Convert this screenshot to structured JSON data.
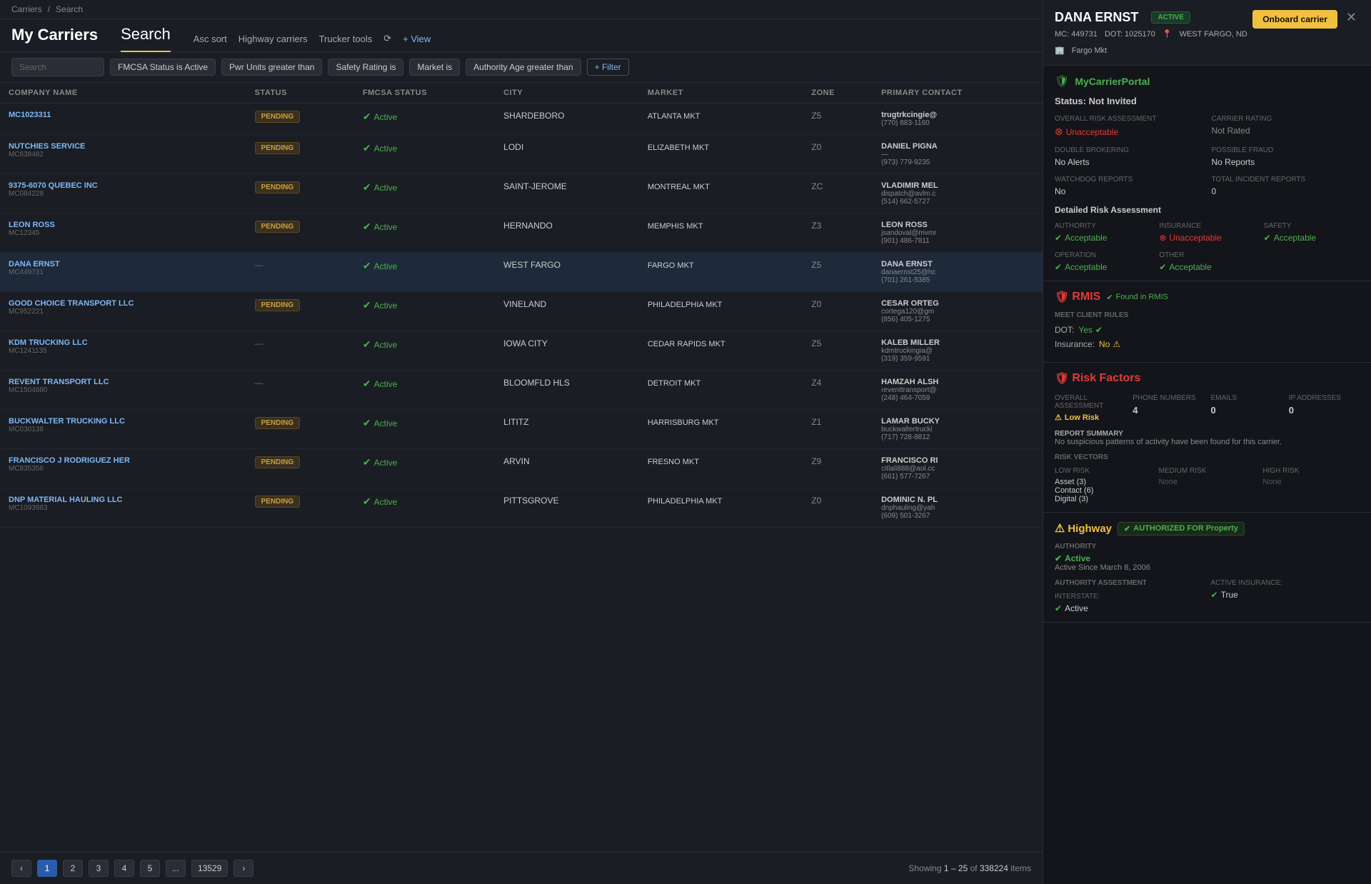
{
  "breadcrumb": {
    "carriers": "Carriers",
    "separator": "/",
    "search": "Search"
  },
  "header": {
    "title": "My Carriers",
    "search_tab": "Search",
    "actions": [
      {
        "label": "Asc sort",
        "name": "asc-sort"
      },
      {
        "label": "Highway carriers",
        "name": "highway-carriers"
      },
      {
        "label": "Trucker tools",
        "name": "trucker-tools"
      },
      {
        "label": "+ View",
        "name": "view"
      }
    ]
  },
  "filters": {
    "search_placeholder": "Search",
    "chips": [
      {
        "label": "FMCSA Status is Active",
        "name": "fmcsa-filter"
      },
      {
        "label": "Pwr Units greater than",
        "name": "pwr-filter"
      },
      {
        "label": "Safety Rating is",
        "name": "safety-filter"
      },
      {
        "label": "Market is",
        "name": "market-filter"
      },
      {
        "label": "Authority Age greater than",
        "name": "authority-filter"
      }
    ],
    "add_filter": "+ Filter"
  },
  "table": {
    "columns": [
      "Company Name",
      "Status",
      "FMCSA Status",
      "City",
      "Market",
      "Zone",
      "Primary Contact"
    ],
    "rows": [
      {
        "company": "MC1023311",
        "status": "PENDING",
        "fmcsa": "Active",
        "city": "SHARDEBORO",
        "market": "ATLANTA MKT",
        "zone": "Z5",
        "contact_name": "trugtrkcingie@",
        "contact_phone": "(770) 883-1160"
      },
      {
        "company": "NUTCHIES SERVICE",
        "mc": "MC638482",
        "status": "PENDING",
        "fmcsa": "Active",
        "city": "LODI",
        "market": "ELIZABETH MKT",
        "zone": "Z0",
        "contact_name": "DANIEL PIGNA",
        "contact_extra": "—",
        "contact_phone": "(973) 779-9235"
      },
      {
        "company": "9375-6070 QUEBEC INC",
        "mc": "MC084228",
        "status": "PENDING",
        "fmcsa": "Active",
        "city": "SAINT-JEROME",
        "market": "MONTREAL MKT",
        "zone": "ZC",
        "contact_name": "VLADIMIR MEL",
        "contact_email": "dispatch@avlm.c",
        "contact_phone": "(514) 662-5727"
      },
      {
        "company": "LEON ROSS",
        "mc": "MC12345",
        "status": "PENDING",
        "fmcsa": "Active",
        "city": "HERNANDO",
        "market": "MEMPHIS MKT",
        "zone": "Z3",
        "contact_name": "LEON ROSS",
        "contact_email": "jsandoval@mvmr",
        "contact_phone": "(901) 486-7811"
      },
      {
        "company": "DANA ERNST",
        "mc": "MC449731",
        "status": "",
        "fmcsa": "Active",
        "city": "WEST FARGO",
        "market": "FARGO MKT",
        "zone": "Z5",
        "contact_name": "DANA ERNST",
        "contact_email": "danaernst25@hc",
        "contact_phone": "(701) 261-5385",
        "selected": true
      },
      {
        "company": "GOOD CHOICE TRANSPORT LLC",
        "mc": "MC952221",
        "status": "PENDING",
        "fmcsa": "Active",
        "city": "VINELAND",
        "market": "PHILADELPHIA MKT",
        "zone": "Z0",
        "contact_name": "CESAR ORTEG",
        "contact_email": "cortega120@gm",
        "contact_phone": "(856) 405-1275"
      },
      {
        "company": "KDM TRUCKING LLC",
        "mc": "MC1241135",
        "status": "",
        "fmcsa": "Active",
        "city": "IOWA CITY",
        "market": "CEDAR RAPIDS MKT",
        "zone": "Z5",
        "contact_name": "KALEB MILLER",
        "contact_email": "kdmtruckingia@",
        "contact_phone": "(319) 359-9591"
      },
      {
        "company": "REVENT TRANSPORT LLC",
        "mc": "MC1504880",
        "status": "",
        "fmcsa": "Active",
        "city": "BLOOMFLD HLS",
        "market": "DETROIT MKT",
        "zone": "Z4",
        "contact_name": "HAMZAH ALSH",
        "contact_email": "reventtransport@",
        "contact_phone": "(248) 464-7059"
      },
      {
        "company": "BUCKWALTER TRUCKING LLC",
        "mc": "MC030138",
        "status": "PENDING",
        "fmcsa": "Active",
        "city": "LITITZ",
        "market": "HARRISBURG MKT",
        "zone": "Z1",
        "contact_name": "LAMAR BUCKY",
        "contact_email": "buckwaltertrucki",
        "contact_phone": "(717) 728-8812"
      },
      {
        "company": "FRANCISCO J RODRIGUEZ HER",
        "mc": "MC835356",
        "status": "PENDING",
        "fmcsa": "Active",
        "city": "ARVIN",
        "market": "FRESNO MKT",
        "zone": "Z9",
        "contact_name": "FRANCISCO RI",
        "contact_email": "citlali888@aol.cc",
        "contact_phone": "(661) 577-7267"
      },
      {
        "company": "DNP MATERIAL HAULING LLC",
        "mc": "MC1093983",
        "status": "PENDING",
        "fmcsa": "Active",
        "city": "PITTSGROVE",
        "market": "PHILADELPHIA MKT",
        "zone": "Z0",
        "contact_name": "DOMINIC N. PL",
        "contact_email": "dnphauling@yah",
        "contact_phone": "(609) 501-3267"
      }
    ]
  },
  "pagination": {
    "prev": "‹",
    "next": "›",
    "pages": [
      "1",
      "2",
      "3",
      "4",
      "5",
      "...",
      "13529"
    ],
    "current": "1",
    "showing_text": "Showing",
    "range": "1 – 25",
    "of": "of",
    "total": "338224",
    "items": "items"
  },
  "right_panel": {
    "carrier_name": "DANA ERNST",
    "status_badge": "ACTIVE",
    "onboard_btn": "Onboard carrier",
    "meta": {
      "mc": "MC: 449731",
      "dot": "DOT: 1025170",
      "location": "WEST FARGO, ND",
      "market": "Fargo Mkt"
    },
    "portal": "MyCarrierPortal",
    "status_section": {
      "title": "Status: Not Invited"
    },
    "overall_risk": {
      "label": "OVERALL RISK ASSESSMENT",
      "value": "Unacceptable"
    },
    "carrier_rating": {
      "label": "CARRIER RATING",
      "value": "Not Rated"
    },
    "double_brokering": {
      "label": "DOUBLE BROKERING",
      "value": "No Alerts"
    },
    "possible_fraud": {
      "label": "POSSIBLE FRAUD",
      "value": "No Reports"
    },
    "watchdog": {
      "label": "WATCHDOG REPORTS",
      "value": "No"
    },
    "total_incident": {
      "label": "TOTAL INCIDENT REPORTS",
      "value": "0"
    },
    "detailed_risk": {
      "title": "Detailed Risk Assessment",
      "authority": {
        "label": "AUTHORITY",
        "value": "Acceptable",
        "type": "ok"
      },
      "insurance": {
        "label": "INSURANCE",
        "value": "Unacceptable",
        "type": "warn"
      },
      "safety": {
        "label": "SAFETY",
        "value": "Acceptable",
        "type": "ok"
      },
      "operation": {
        "label": "OPERATION",
        "value": "Acceptable",
        "type": "ok"
      },
      "other": {
        "label": "OTHER",
        "value": "Acceptable",
        "type": "ok"
      }
    },
    "rmis": {
      "logo": "RMIS",
      "found": "Found in RMIS",
      "meet_rules_title": "MEET CLIENT RULES",
      "dot_label": "DOT:",
      "dot_value": "Yes",
      "insurance_label": "Insurance:",
      "insurance_value": "No"
    },
    "risk_factors": {
      "logo": "Risk Factors",
      "overall": {
        "label": "OVERALL ASSESSMENT",
        "value": "Low Risk"
      },
      "phone_numbers": {
        "label": "PHONE NUMBERS",
        "value": "4"
      },
      "emails": {
        "label": "EMAILS",
        "value": "0"
      },
      "ip_addresses": {
        "label": "IP ADDRESSES",
        "value": "0"
      },
      "report_title": "REPORT SUMMARY",
      "report_text": "No suspicious patterns of activity have been found for this carrier.",
      "risk_vectors_title": "RISK VECTORS",
      "low_risk": {
        "label": "LOW RISK",
        "value": "Asset (3)\nContact (6)\nDigital (3)"
      },
      "medium_risk": {
        "label": "MEDIUM RISK",
        "value": "None"
      },
      "high_risk": {
        "label": "HIGH RISK",
        "value": "None"
      }
    },
    "highway": {
      "logo": "Highway",
      "authorized": "AUTHORIZED FOR Property",
      "authority_label": "AUTHORITY",
      "authority_value": "Active",
      "since": "Active Since March 8, 2006",
      "assess_title": "AUTHORITY ASSESTMENT",
      "interstate": {
        "label": "Interstate:",
        "value": "Active"
      },
      "active_insurance": {
        "label": "Active Insurance:",
        "value": "True"
      }
    }
  }
}
